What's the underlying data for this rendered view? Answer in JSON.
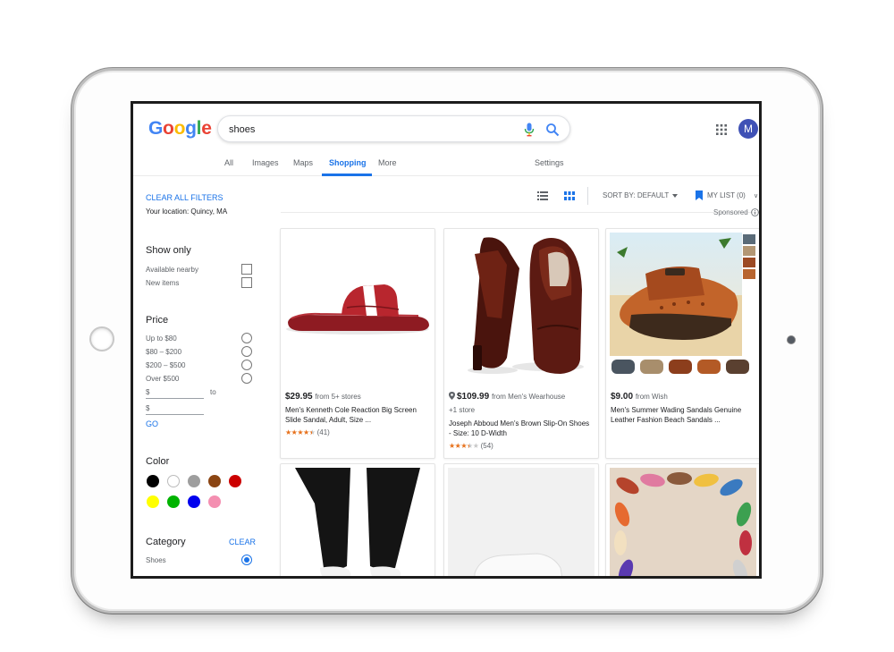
{
  "header": {
    "logo_letters": [
      {
        "ch": "G",
        "color": "#4285f4"
      },
      {
        "ch": "o",
        "color": "#ea4335"
      },
      {
        "ch": "o",
        "color": "#fbbc05"
      },
      {
        "ch": "g",
        "color": "#4285f4"
      },
      {
        "ch": "l",
        "color": "#34a853"
      },
      {
        "ch": "e",
        "color": "#ea4335"
      }
    ],
    "search_value": "shoes",
    "avatar_letter": "M"
  },
  "tabs": {
    "all": "All",
    "images": "Images",
    "maps": "Maps",
    "shopping": "Shopping",
    "more": "More",
    "settings": "Settings"
  },
  "sidebar": {
    "clear_all": "CLEAR ALL FILTERS",
    "location": "Your location: Quincy, MA",
    "show_only": {
      "heading": "Show only",
      "options": [
        "Available nearby",
        "New items"
      ]
    },
    "price": {
      "heading": "Price",
      "options": [
        "Up to $80",
        "$80 – $200",
        "$200 – $500",
        "Over $500"
      ],
      "min_symbol": "$",
      "to": "to",
      "max_symbol": "$",
      "go": "GO"
    },
    "color": {
      "heading": "Color",
      "swatches": [
        "#000000",
        "#ffffff",
        "#9e9e9e",
        "#8b4513",
        "#cc0000",
        "#ffff00",
        "#00b300",
        "#0000ee",
        "#f48fb1"
      ]
    },
    "category": {
      "heading": "Category",
      "clear": "CLEAR",
      "selected": "Shoes"
    }
  },
  "toolbar": {
    "sort": "SORT BY: DEFAULT",
    "mylist": "MY LIST (0)",
    "sponsored": "Sponsored"
  },
  "products": [
    {
      "price": "$29.95",
      "from": "from 5+ stores",
      "title": "Men's Kenneth Cole Reaction Big Screen Slide Sandal, Adult, Size ...",
      "stars": 4.5,
      "reviews": "(41)"
    },
    {
      "price": "$109.99",
      "from": "from Men's Wearhouse",
      "extra": "+1 store",
      "title": "Joseph Abboud Men's Brown Slip-On Shoes - Size: 10 D-Width",
      "stars": 3.5,
      "reviews": "(54)"
    },
    {
      "price": "$9.00",
      "from": "from Wish",
      "title": "Men's Summer Wading Sandals Genuine Leather Fashion Beach Sandals ..."
    }
  ]
}
